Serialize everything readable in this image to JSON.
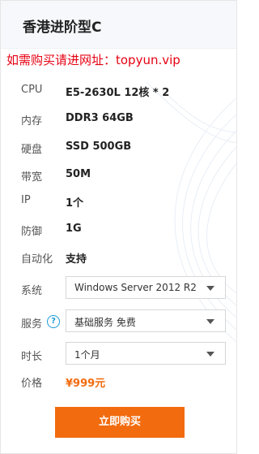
{
  "title": "香港进阶型C",
  "promo": "如需购买请进网址：topyun.vip",
  "specs": [
    {
      "label": "CPU",
      "value": "E5-2630L 12核 * 2"
    },
    {
      "label": "内存",
      "value": "DDR3 64GB"
    },
    {
      "label": "硬盘",
      "value": "SSD 500GB"
    },
    {
      "label": "带宽",
      "value": "50M"
    },
    {
      "label": "IP",
      "value": "1个"
    },
    {
      "label": "防御",
      "value": "1G"
    },
    {
      "label": "自动化",
      "value": "支持"
    }
  ],
  "options": {
    "system": {
      "label": "系统",
      "value": "Windows Server 2012 R2"
    },
    "service": {
      "label": "服务",
      "value": "基础服务 免费",
      "help_icon": "?"
    },
    "duration": {
      "label": "时长",
      "value": "1个月"
    }
  },
  "price": {
    "label": "价格",
    "value": "¥999元"
  },
  "buy_button": "立即购买",
  "colors": {
    "accent": "#f26b0e",
    "promo": "#e60012",
    "help": "#1a9bd7"
  }
}
